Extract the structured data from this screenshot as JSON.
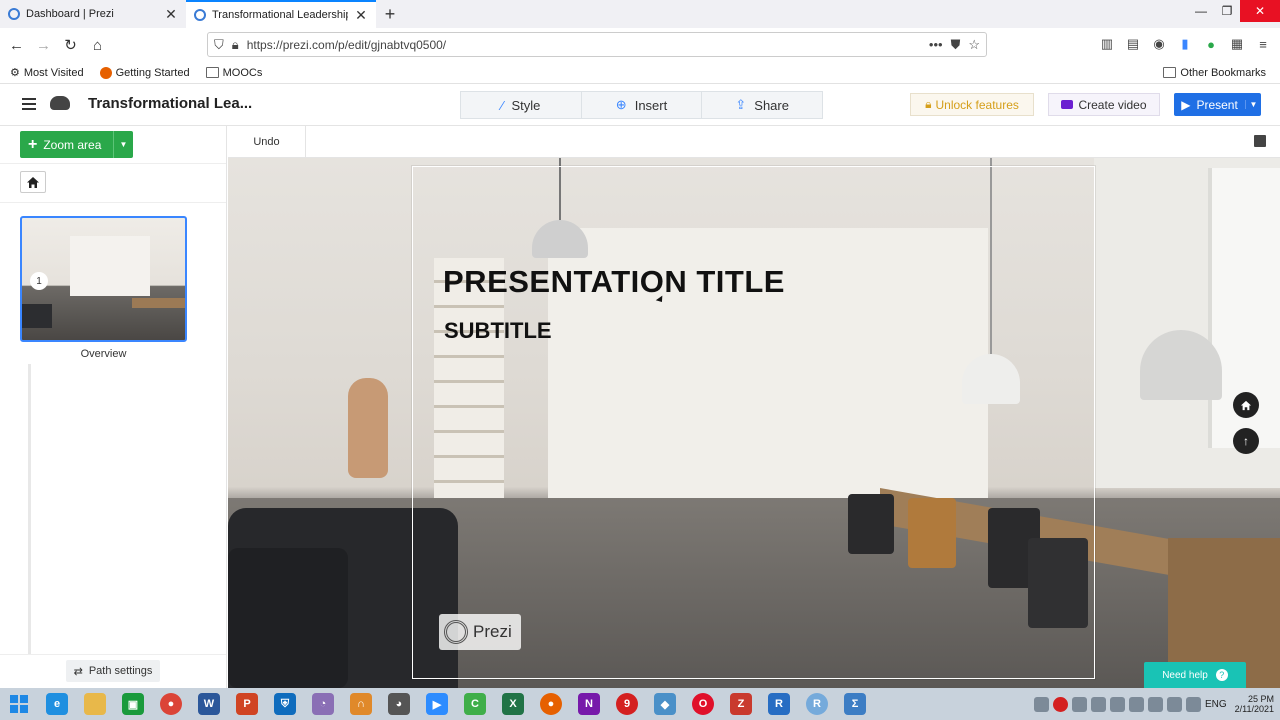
{
  "browser": {
    "tabs": [
      {
        "title": "Dashboard | Prezi",
        "active": false
      },
      {
        "title": "Transformational Leadership | P",
        "active": true
      }
    ],
    "url": "https://prezi.com/p/edit/gjnabtvq0500/",
    "bookmarks": [
      "Most Visited",
      "Getting Started",
      "MOOCs"
    ],
    "other_bookmarks": "Other Bookmarks"
  },
  "prezi": {
    "title": "Transformational Lea...",
    "toolbar": {
      "style": "Style",
      "insert": "Insert",
      "share": "Share"
    },
    "unlock": "Unlock features",
    "create_video": "Create video",
    "present": "Present",
    "zoom_area": "Zoom area",
    "undo": "Undo",
    "overview_label": "Overview",
    "thumb_number": "1",
    "path_settings": "Path settings",
    "slide": {
      "title": "PRESENTATION TITLE",
      "subtitle": "SUBTITLE",
      "logo_text": "Prezi"
    },
    "need_help": "Need help"
  },
  "taskbar": {
    "language": "ENG",
    "clock_time": "25 PM",
    "clock_date": "2/11/2021"
  },
  "colors": {
    "present_blue": "#1f6fe5",
    "zoom_green": "#2aa84a",
    "help_teal": "#19c3b5",
    "unlock_gold": "#d59f1a"
  }
}
